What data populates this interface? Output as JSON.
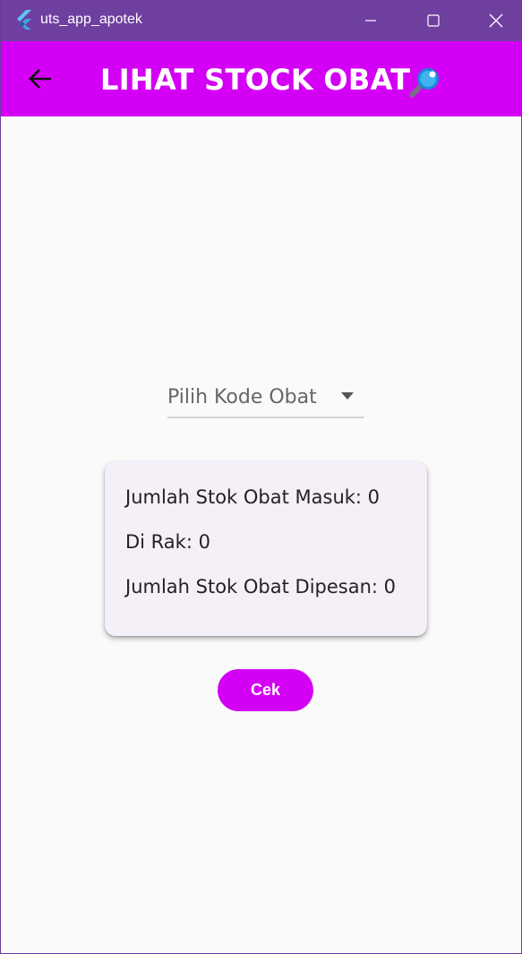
{
  "window": {
    "title": "uts_app_apotek"
  },
  "appbar": {
    "title": "LIHAT STOCK OBAT",
    "title_icon": "magnifying-glass-emoji",
    "back_icon": "arrow-left-icon"
  },
  "dropdown": {
    "placeholder": "Pilih Kode Obat",
    "icon": "caret-down-icon"
  },
  "stock_card": {
    "masuk": "Jumlah Stok Obat Masuk: 0",
    "rak": "Di Rak: 0",
    "dipesan": "Jumlah Stok Obat Dipesan: 0"
  },
  "actions": {
    "cek_label": "Cek"
  },
  "colors": {
    "titlebar": "#6f3f9f",
    "accent": "#d400f5",
    "card": "#f5eff8",
    "background": "#fafafa"
  }
}
